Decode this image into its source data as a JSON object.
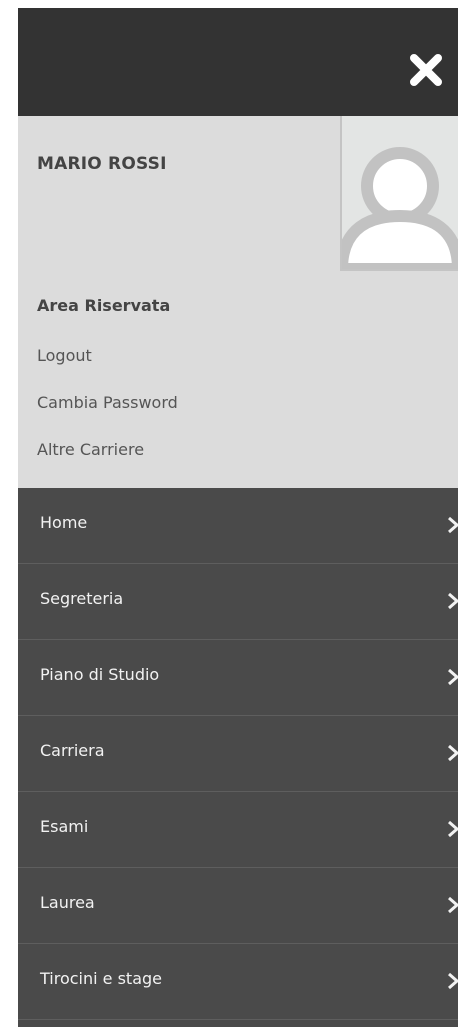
{
  "header": {
    "close_icon": "close-icon"
  },
  "user": {
    "name": "MARIO ROSSI",
    "avatar_icon": "avatar-placeholder-icon"
  },
  "reserved_area": {
    "title": "Area Riservata",
    "links": [
      "Logout",
      "Cambia Password",
      "Altre Carriere"
    ]
  },
  "menu": {
    "items": [
      "Home",
      "Segreteria",
      "Piano di Studio",
      "Carriera",
      "Esami",
      "Laurea",
      "Tirocini e stage"
    ],
    "chevron_icon": "chevron-right-icon"
  },
  "colors": {
    "topbar": "#333333",
    "user_area": "#dcdcdc",
    "menu_bg": "#4a4a4a",
    "menu_text": "#f2f2f2"
  }
}
